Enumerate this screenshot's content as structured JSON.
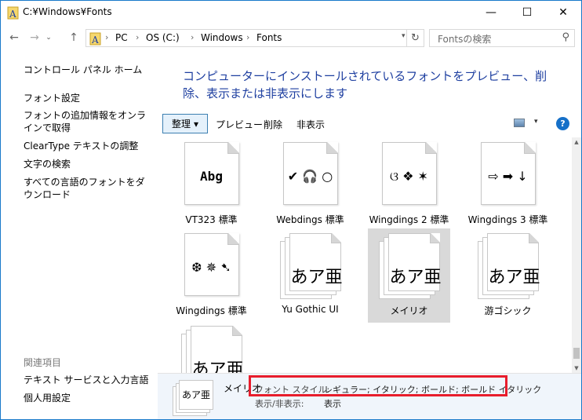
{
  "window": {
    "title": "C:¥Windows¥Fonts",
    "minimize": "—",
    "maximize": "☐",
    "close": "✕"
  },
  "nav": {
    "back": "←",
    "forward": "→",
    "history": "⌄",
    "up": "↑",
    "breadcrumbs": [
      "PC",
      "OS (C:)",
      "Windows",
      "Fonts"
    ],
    "separator": "›",
    "refresh": "↻",
    "search_placeholder": "Fontsの検索",
    "search_icon": "⚲"
  },
  "sidebar": {
    "home": "コントロール パネル ホーム",
    "links": [
      "フォント設定",
      "フォントの追加情報をオンラインで取得",
      "ClearType テキストの調整",
      "文字の検索",
      "すべての言語のフォントをダウンロード"
    ],
    "related_heading": "関連項目",
    "related": [
      "テキスト サービスと入力言語",
      "個人用設定"
    ]
  },
  "heading": "コンピューターにインストールされているフォントをプレビュー、削除、表示または非表示にします",
  "toolbar": {
    "organize": "整理",
    "organize_caret": "▾",
    "preview": "プレビュー",
    "delete": "削除",
    "hide": "非表示",
    "view_caret": "▾",
    "help": "?"
  },
  "fonts": [
    {
      "sample": "Abg",
      "label": "VT323 標準"
    },
    {
      "sample": "✔ 🎧 ○",
      "label": "Webdings 標準"
    },
    {
      "sample": "ଓ ❖ ✶",
      "label": "Wingdings 2 標準"
    },
    {
      "sample": "⇨ ➡ ↓",
      "label": "Wingdings 3 標準"
    },
    {
      "sample": "❆ ✵ ➷",
      "label": "Wingdings 標準"
    },
    {
      "sample": "あア亜",
      "label": "Yu Gothic UI"
    },
    {
      "sample": "あア亜",
      "label": "メイリオ"
    },
    {
      "sample": "あア亜",
      "label": "游ゴシック"
    },
    {
      "sample": "あア亜",
      "label": ""
    }
  ],
  "details": {
    "icon_sample": "あア亜",
    "name": "メイリオ",
    "style_label": "フォント スタイル:",
    "style_value": "レギュラー; イタリック; ボールド; ボールド イタリック",
    "visibility_label": "表示/非表示:",
    "visibility_value": "表示"
  },
  "colors": {
    "heading": "#1e3fa0",
    "selection_box": "#e81d2c",
    "window_border": "#1979ca"
  }
}
